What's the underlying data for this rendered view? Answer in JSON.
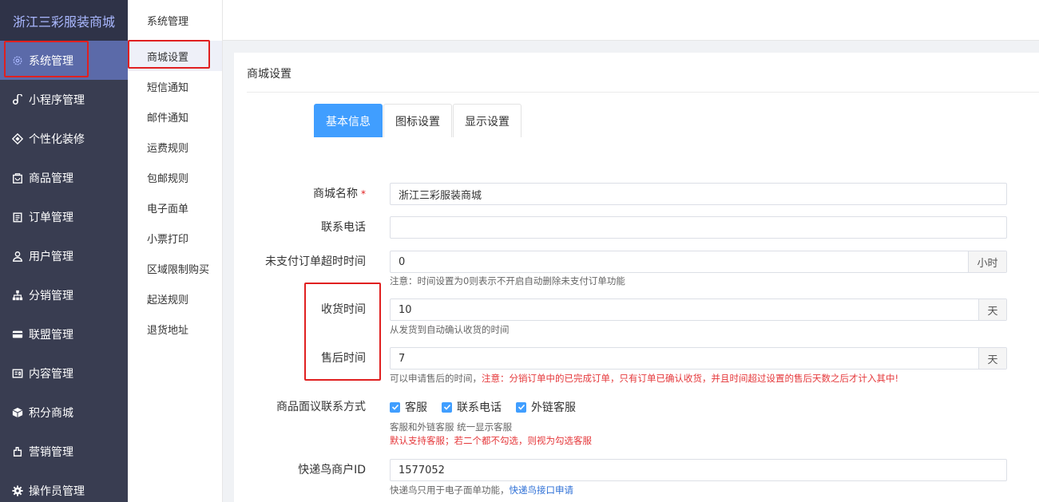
{
  "brand": "浙江三彩服装商城",
  "sidebar": {
    "items": [
      {
        "label": "系统管理",
        "icon": "gear-icon"
      },
      {
        "label": "小程序管理",
        "icon": "link-icon"
      },
      {
        "label": "个性化装修",
        "icon": "diamond-icon"
      },
      {
        "label": "商品管理",
        "icon": "bag-icon"
      },
      {
        "label": "订单管理",
        "icon": "clipboard-icon"
      },
      {
        "label": "用户管理",
        "icon": "user-icon"
      },
      {
        "label": "分销管理",
        "icon": "org-chart-icon"
      },
      {
        "label": "联盟管理",
        "icon": "card-icon"
      },
      {
        "label": "内容管理",
        "icon": "document-icon"
      },
      {
        "label": "积分商城",
        "icon": "cube-icon"
      },
      {
        "label": "营销管理",
        "icon": "hand-icon"
      },
      {
        "label": "操作员管理",
        "icon": "cog-icon"
      }
    ]
  },
  "subnav": {
    "header": "系统管理",
    "items": [
      "商城设置",
      "短信通知",
      "邮件通知",
      "运费规则",
      "包邮规则",
      "电子面单",
      "小票打印",
      "区域限制购买",
      "起送规则",
      "退货地址"
    ]
  },
  "card": {
    "title": "商城设置",
    "tabs": [
      "基本信息",
      "图标设置",
      "显示设置"
    ]
  },
  "form": {
    "shop_name": {
      "label": "商城名称",
      "required_mark": "*",
      "value": "浙江三彩服装商城"
    },
    "phone": {
      "label": "联系电话",
      "value": ""
    },
    "unpaid_timeout": {
      "label": "未支付订单超时时间",
      "value": "0",
      "unit": "小时",
      "hint": "注意：时间设置为0则表示不开启自动删除未支付订单功能"
    },
    "receive_time": {
      "label": "收货时间",
      "value": "10",
      "unit": "天",
      "hint": "从发货到自动确认收货的时间"
    },
    "aftersale_time": {
      "label": "售后时间",
      "value": "7",
      "unit": "天",
      "hint": "可以申请售后的时间，",
      "hint_warn": "注意：分销订单中的已完成订单，只有订单已确认收货，并且时间超过设置的售后天数之后才计入其中!"
    },
    "contact_methods": {
      "label": "商品面议联系方式",
      "options": [
        "客服",
        "联系电话",
        "外链客服"
      ],
      "hint1": "客服和外链客服 统一显示客服",
      "hint2": "默认支持客服；若二个都不勾选，则视为勾选客服"
    },
    "kdn_id": {
      "label": "快递鸟商户ID",
      "value": "1577052",
      "hint": "快递鸟只用于电子面单功能，",
      "hint_link": "快递鸟接口申请"
    }
  },
  "colors": {
    "accent": "#409eff",
    "sidebar_bg": "#393d51",
    "active_nav": "#5b6aa9",
    "highlight_box": "#e02020"
  }
}
